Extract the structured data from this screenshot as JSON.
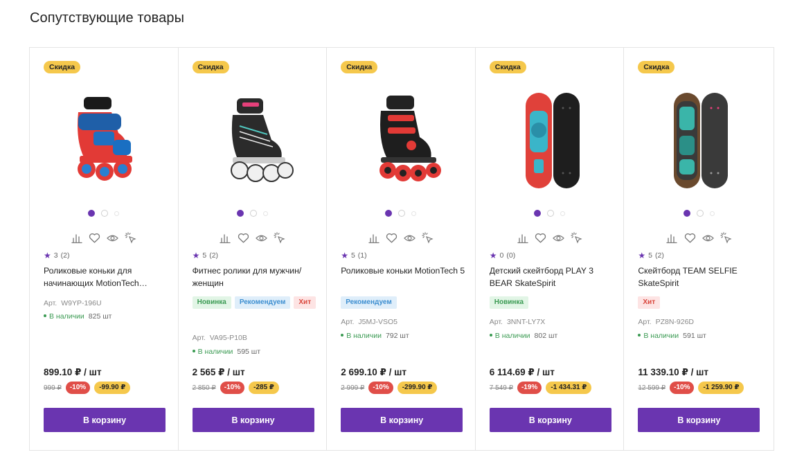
{
  "section_title": "Сопутствующие товары",
  "accent_color": "#6a35b0",
  "icons": {
    "compare": "compare-icon",
    "favorite": "heart-icon",
    "quick_view": "eye-icon",
    "one_click": "click-pointer-icon",
    "rating": "star-icon"
  },
  "products": [
    {
      "discount_tag": "Скидка",
      "rating": "3",
      "reviews": "(2)",
      "title": "Роликовые коньки для начинающих MotionTech…",
      "badges": [],
      "sku_label": "Арт.",
      "sku": "W9YP-196U",
      "stock_label": "В наличии",
      "stock_qty": "825 шт",
      "price": "899.10 ₽ / шт",
      "old_price": "999 ₽",
      "discount_pct": "-10%",
      "discount_amount": "-99.90 ₽",
      "cart_label": "В корзину"
    },
    {
      "discount_tag": "Скидка",
      "rating": "5",
      "reviews": "(2)",
      "title": "Фитнес ролики для мужчин/женщин",
      "badges": [
        {
          "type": "new",
          "label": "Новинка"
        },
        {
          "type": "rec",
          "label": "Рекомендуем"
        },
        {
          "type": "hit",
          "label": "Хит"
        }
      ],
      "sku_label": "Арт.",
      "sku": "VA95-P10B",
      "stock_label": "В наличии",
      "stock_qty": "595 шт",
      "price": "2 565 ₽ / шт",
      "old_price": "2 850 ₽",
      "discount_pct": "-10%",
      "discount_amount": "-285 ₽",
      "cart_label": "В корзину"
    },
    {
      "discount_tag": "Скидка",
      "rating": "5",
      "reviews": "(1)",
      "title": "Роликовые коньки MotionTech 5",
      "badges": [
        {
          "type": "rec",
          "label": "Рекомендуем"
        }
      ],
      "sku_label": "Арт.",
      "sku": "J5MJ-VSO5",
      "stock_label": "В наличии",
      "stock_qty": "792 шт",
      "price": "2 699.10 ₽ / шт",
      "old_price": "2 999 ₽",
      "discount_pct": "-10%",
      "discount_amount": "-299.90 ₽",
      "cart_label": "В корзину"
    },
    {
      "discount_tag": "Скидка",
      "rating": "0",
      "reviews": "(0)",
      "title": "Детский скейтборд PLAY 3 BEAR SkateSpirit",
      "badges": [
        {
          "type": "new",
          "label": "Новинка"
        }
      ],
      "sku_label": "Арт.",
      "sku": "3NNT-LY7X",
      "stock_label": "В наличии",
      "stock_qty": "802 шт",
      "price": "6 114.69 ₽ / шт",
      "old_price": "7 549 ₽",
      "discount_pct": "-19%",
      "discount_amount": "-1 434.31 ₽",
      "cart_label": "В корзину"
    },
    {
      "discount_tag": "Скидка",
      "rating": "5",
      "reviews": "(2)",
      "title": "Скейтборд TEAM SELFIE SkateSpirit",
      "badges": [
        {
          "type": "hit",
          "label": "Хит"
        }
      ],
      "sku_label": "Арт.",
      "sku": "PZ8N-926D",
      "stock_label": "В наличии",
      "stock_qty": "591 шт",
      "price": "11 339.10 ₽ / шт",
      "old_price": "12 599 ₽",
      "discount_pct": "-10%",
      "discount_amount": "-1 259.90 ₽",
      "cart_label": "В корзину"
    }
  ]
}
